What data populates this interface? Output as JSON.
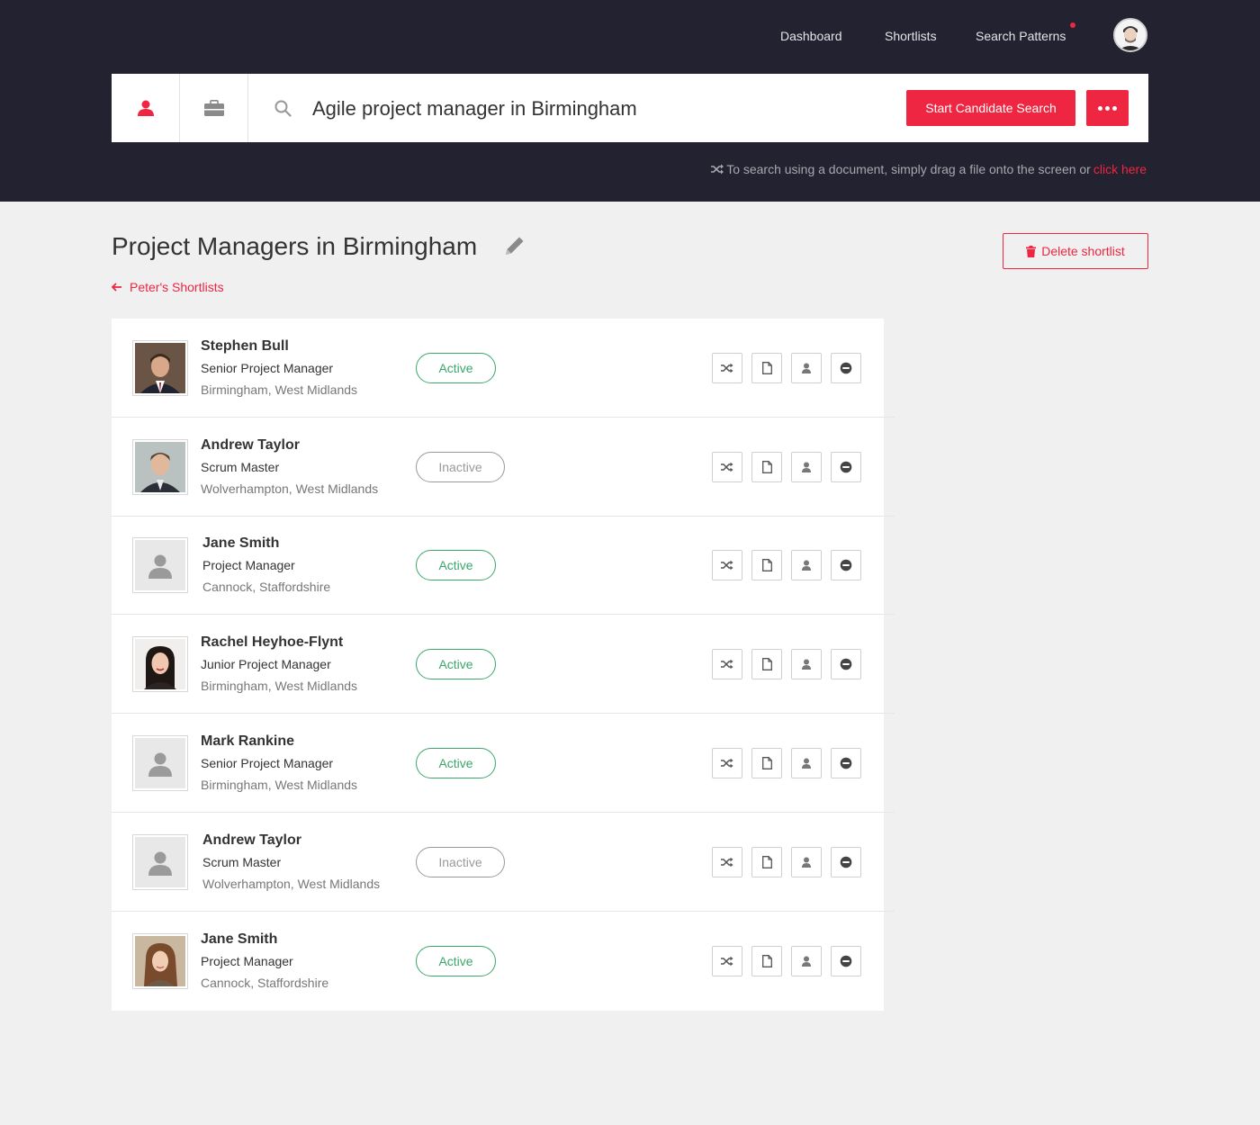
{
  "nav": {
    "dashboard": "Dashboard",
    "shortlists": "Shortlists",
    "search_patterns": "Search Patterns"
  },
  "search": {
    "query": "Agile project manager in Birmingham",
    "start_button": "Start Candidate Search",
    "hint_text": "To search using a document, simply drag a file onto the screen or",
    "hint_link": "click here"
  },
  "page": {
    "title": "Project Managers in Birmingham",
    "back_link": "Peter's Shortlists",
    "delete_button": "Delete shortlist"
  },
  "candidates": [
    {
      "name": "Stephen Bull",
      "title": "Senior Project Manager",
      "location": "Birmingham, West Midlands",
      "status": "Active"
    },
    {
      "name": "Andrew Taylor",
      "title": "Scrum Master",
      "location": "Wolverhampton, West Midlands",
      "status": "Inactive"
    },
    {
      "name": "Jane Smith",
      "title": "Project Manager",
      "location": "Cannock, Staffordshire",
      "status": "Active"
    },
    {
      "name": "Rachel Heyhoe-Flynt",
      "title": "Junior Project Manager",
      "location": "Birmingham, West Midlands",
      "status": "Active"
    },
    {
      "name": "Mark Rankine",
      "title": "Senior Project Manager",
      "location": "Birmingham, West Midlands",
      "status": "Active"
    },
    {
      "name": "Andrew Taylor",
      "title": "Scrum Master",
      "location": "Wolverhampton, West Midlands",
      "status": "Inactive"
    },
    {
      "name": "Jane Smith",
      "title": "Project Manager",
      "location": "Cannock, Staffordshire",
      "status": "Active"
    }
  ],
  "colors": {
    "accent": "#ee2641",
    "header_bg": "#222230",
    "active": "#3aa66a",
    "inactive": "#999999"
  },
  "icons": {
    "row_actions": [
      "shuffle-icon",
      "document-icon",
      "profile-icon",
      "remove-icon"
    ]
  }
}
